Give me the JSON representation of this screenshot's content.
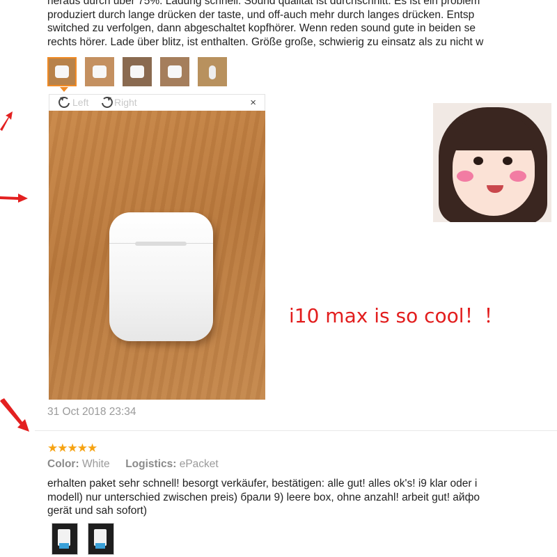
{
  "review1": {
    "text_lines": [
      "heraus durch über 75%. Ladung schnell. Sound qualität ist durchschnitt. Es ist ein problem",
      "produziert durch lange drücken der taste, und off-auch mehr durch langes drücken. Entsp",
      "switched zu verfolgen, dann abgeschaltet kopfhörer. Wenn reden sound gute in beiden se",
      "rechts hörer. Lade über blitz, ist enthalten. Größe große, schwierig zu einsatz als zu nicht w"
    ],
    "thumbnails_count": 5,
    "selected_thumbnail": 1,
    "viewer": {
      "rotate_left_label": "Left",
      "rotate_right_label": "Right",
      "close_label": "×"
    },
    "date": "31 Oct 2018 23:34"
  },
  "overlay": {
    "caption": "i10 max is so cool！！"
  },
  "review2": {
    "stars": "★★★★★",
    "rating": 5,
    "color_label": "Color:",
    "color_value": "White",
    "logistics_label": "Logistics:",
    "logistics_value": "ePacket",
    "text_lines": [
      "erhalten paket sehr schnell! besorgt verkäufer, bestätigen: alle gut! alles ok's! i9 klar oder i",
      "modell) nur unterschied zwischen preis) брали 9) leere box, ohne anzahl! arbeit gut! айфо",
      "gerät und sah sofort)"
    ],
    "thumbnails_count": 2
  },
  "colors": {
    "accent": "#f08a24",
    "star": "#f6a313",
    "caption": "#e21d1d",
    "arrow": "#e32020"
  },
  "icons": [
    "rotate-left-icon",
    "rotate-right-icon",
    "close-icon",
    "red-arrow-icon",
    "star-icon"
  ]
}
